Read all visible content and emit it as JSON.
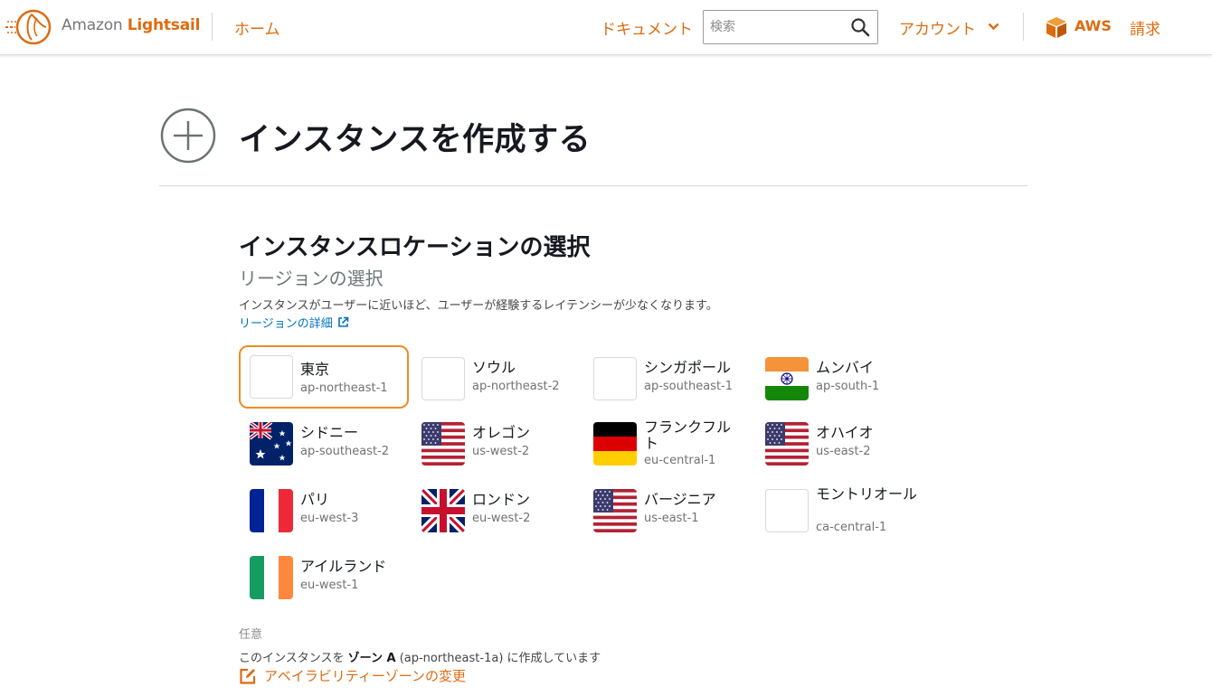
{
  "header": {
    "brand_prefix": "Amazon",
    "brand_name": "Lightsail",
    "home": "ホーム",
    "docs": "ドキュメント",
    "search_placeholder": "検索",
    "account": "アカウント",
    "aws": "AWS",
    "billing": "請求"
  },
  "page": {
    "title": "インスタンスを作成する"
  },
  "location": {
    "title": "インスタンスロケーションの選択",
    "subtitle": "リージョンの選択",
    "description": "インスタンスがユーザーに近いほど、ユーザーが経験するレイテンシーが少なくなります。",
    "link": "リージョンの詳細",
    "selected_region": "ap-northeast-1",
    "regions": [
      {
        "name": "東京",
        "code": "ap-northeast-1",
        "flag": "japan-flag"
      },
      {
        "name": "ソウル",
        "code": "ap-northeast-2",
        "flag": "south-korea-flag"
      },
      {
        "name": "シンガポール",
        "code": "ap-southeast-1",
        "flag": "singapore-flag"
      },
      {
        "name": "ムンバイ",
        "code": "ap-south-1",
        "flag": "india-flag"
      },
      {
        "name": "シドニー",
        "code": "ap-southeast-2",
        "flag": "australia-flag"
      },
      {
        "name": "オレゴン",
        "code": "us-west-2",
        "flag": "usa-flag"
      },
      {
        "name": "フランクフルト",
        "code": "eu-central-1",
        "flag": "germany-flag"
      },
      {
        "name": "オハイオ",
        "code": "us-east-2",
        "flag": "usa-flag"
      },
      {
        "name": "パリ",
        "code": "eu-west-3",
        "flag": "france-flag"
      },
      {
        "name": "ロンドン",
        "code": "eu-west-2",
        "flag": "uk-flag"
      },
      {
        "name": "バージニア",
        "code": "us-east-1",
        "flag": "usa-flag"
      },
      {
        "name": "モントリオール",
        "code": "ca-central-1",
        "flag": "canada-flag"
      },
      {
        "name": "アイルランド",
        "code": "eu-west-1",
        "flag": "ireland-flag"
      }
    ]
  },
  "availability": {
    "optional": "任意",
    "line_prefix": "このインスタンスを ",
    "zone": "ゾーン A",
    "line_suffix": " (ap-northeast-1a) に作成しています",
    "change": "アベイラビリティーゾーンの変更"
  },
  "colors": {
    "accent": "#dd6b10",
    "link": "#0073bb",
    "selected_border": "#ec8c25"
  }
}
